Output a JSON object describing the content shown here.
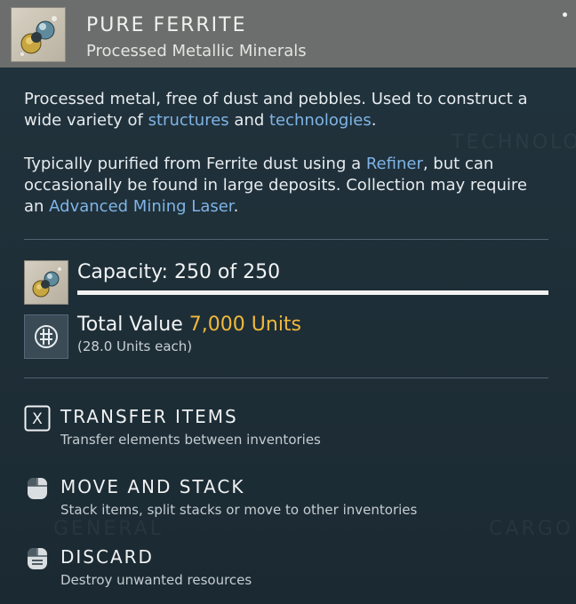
{
  "item": {
    "title": "PURE FERRITE",
    "subtitle": "Processed Metallic Minerals",
    "icon": "ferrite-sphere-icon"
  },
  "description": {
    "p1_before": "Processed metal, free of dust and pebbles. Used to construct a wide variety of ",
    "p1_link1": "structures",
    "p1_mid": " and ",
    "p1_link2": "technologies",
    "p1_after": ".",
    "p2_before": "Typically purified from Ferrite dust using a ",
    "p2_link1": "Refiner",
    "p2_mid": ", but can occasionally be found in large deposits. Collection may require an ",
    "p2_link2": "Advanced Mining Laser",
    "p2_after": "."
  },
  "capacity": {
    "label": "Capacity: 250 of 250",
    "fill_fraction": 1.0
  },
  "value": {
    "label": "Total Value",
    "amount": "7,000 Units",
    "each": "(28.0 Units each)"
  },
  "actions": [
    {
      "key": "X",
      "title": "TRANSFER ITEMS",
      "desc": "Transfer elements between inventories",
      "icon": "x-key-icon"
    },
    {
      "title": "MOVE AND STACK",
      "desc": "Stack items, split stacks or move to other inventories",
      "icon": "mouse-left-button-icon"
    },
    {
      "title": "DISCARD",
      "desc": "Destroy unwanted resources",
      "icon": "mouse-hold-icon"
    }
  ],
  "watermarks": [
    "TECHNOLO",
    "GENERAL",
    "CARGO"
  ],
  "colors": {
    "header_bg": "#6c6e6d",
    "panel_bg": "#1f2f38",
    "link": "#7fb4e6",
    "value_amount": "#f0b93a"
  }
}
